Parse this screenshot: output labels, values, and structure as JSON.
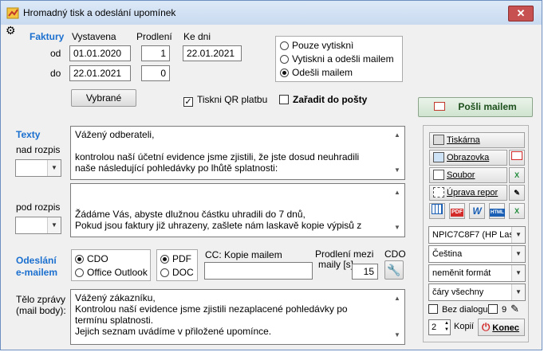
{
  "window": {
    "title": "Hromadný tisk a odeslání upomínek",
    "close": "✕"
  },
  "faktury": {
    "label": "Faktury",
    "col_vystavena": "Vystavena",
    "col_prodleni": "Prodlení",
    "col_ke_dni": "Ke dni",
    "row_od": "od",
    "row_do": "do",
    "vystavena_od": "01.01.2020",
    "vystavena_do": "22.01.2021",
    "prodleni_od": "1",
    "prodleni_do": "0",
    "ke_dni": "22.01.2021",
    "vybrane_button": "Vybrané"
  },
  "mode": {
    "options": [
      "Pouze vytisknì",
      "Vytiskni a odešli mailem",
      "Odešli mailem"
    ],
    "selected": 2
  },
  "options": {
    "qr_label": "Tiskni QR platbu",
    "qr_checked": true,
    "posta_label": "Zařadit do pošty",
    "posta_checked": false
  },
  "send_button": "Pošli mailem",
  "texty": {
    "label": "Texty",
    "nad_label": "nad rozpis",
    "pod_label": "pod rozpis",
    "nad_text": "Vážený odberateli,\n\nkontrolou naší účetní evidence jsme zjistili, že jste dosud neuhradili\nnaše následující pohledávky po lhůtě splatnosti:",
    "pod_text": "\n\nŽádáme Vás, abyste dlužnou částku uhradili do 7 dnů,\nPokud jsou faktury již uhrazeny, zašlete nám laskavě kopie výpisů z"
  },
  "odeslani": {
    "label_line1": "Odeslání",
    "label_line2": "e-mailem",
    "client_options": [
      "CDO",
      "Office Outlook"
    ],
    "client_selected": 0,
    "format_options": [
      "PDF",
      "DOC"
    ],
    "format_selected": 0,
    "cc_label": "CC: Kopie mailem",
    "cc_value": "",
    "delay_label_line1": "Prodlení mezi",
    "delay_label_line2": "maily [s]",
    "delay_value": "15",
    "cdo_label": "CDO"
  },
  "telo": {
    "label_line1": "Tělo zprávy",
    "label_line2": "(mail body):",
    "text": "Vážený zákazníku,\nKontrolou naší evidence jsme zjistili nezaplacené pohledávky po\ntermínu splatnosti.\nJejich seznam uvádíme v přiložené upomínce."
  },
  "output_panel": {
    "tiskarna": "Tiskárna",
    "obrazovka": "Obrazovka",
    "soubor": "Soubor",
    "uprava": "Úprava repor",
    "format_icons": [
      "calendar-grid",
      "PDF",
      "W",
      "HTML",
      "X"
    ],
    "printer_select": "NPIC7C8F7 (HP Lase",
    "language_select": "Čeština",
    "format_select": "neměnit formát",
    "lines_select": "čáry všechny",
    "bez_dialogu_label": "Bez dialogu",
    "bez_dialogu_checked": false,
    "count_checkbox_value": "9",
    "kopii_value": "2",
    "kopii_label": "Kopií",
    "konec_label": "Konec"
  },
  "colors": {
    "accent_blue": "#1a6fcf",
    "close_red": "#c75050",
    "excel_green": "#1f8a3a",
    "pdf_red": "#d32a2a"
  }
}
